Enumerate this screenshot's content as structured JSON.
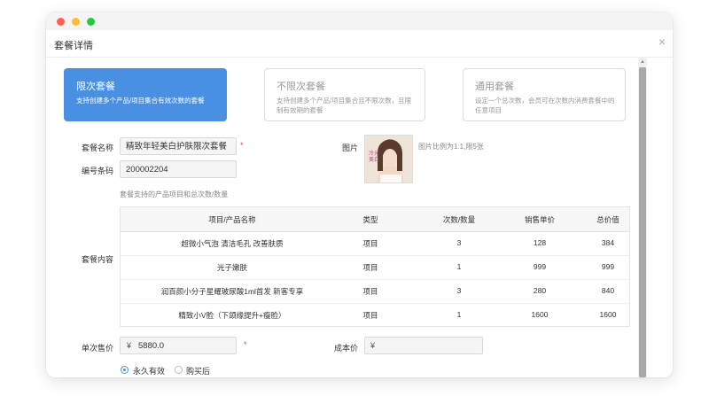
{
  "dialog": {
    "title": "套餐详情",
    "close": "×"
  },
  "types": [
    {
      "title": "限次套餐",
      "desc": "支持创建多个产品/项目集合有效次数的套餐"
    },
    {
      "title": "不限次套餐",
      "desc": "支持创建多个产品/项目集合且不限次数，且限制有效期的套餐"
    },
    {
      "title": "通用套餐",
      "desc": "设定一个总次数，会员可在次数内消费套餐中的任意项目"
    }
  ],
  "form": {
    "name_label": "套餐名称",
    "name_value": "精致年轻美白护肤限次套餐",
    "code_label": "编号条码",
    "code_value": "200002204",
    "image_label": "图片",
    "image_hint": "图片比例为1:1,限5张",
    "image_text": "冷光美白",
    "content_hint": "套餐支持的产品项目和总次数/数量",
    "content_label": "套餐内容",
    "price_label": "单次售价",
    "price_value": "5880.0",
    "cost_label": "成本价",
    "currency": "¥",
    "required_mark": "*",
    "validity_options": [
      "永久有效",
      "购买后"
    ]
  },
  "table": {
    "headers": [
      "项目/产品名称",
      "类型",
      "次数/数量",
      "销售单价",
      "总价值"
    ],
    "rows": [
      [
        "超微小气泡 清洁毛孔 改善肤质",
        "项目",
        "3",
        "128",
        "384"
      ],
      [
        "光子嫩肤",
        "项目",
        "1",
        "999",
        "999"
      ],
      [
        "润百颜小分子星耀玻尿酸1ml首发 新客专享",
        "项目",
        "3",
        "280",
        "840"
      ],
      [
        "精致小V脸（下颌缘提升+瘦脸）",
        "项目",
        "1",
        "1600",
        "1600"
      ]
    ]
  },
  "colors": {
    "accent": "#4a90e2",
    "required": "#e74c3c"
  }
}
